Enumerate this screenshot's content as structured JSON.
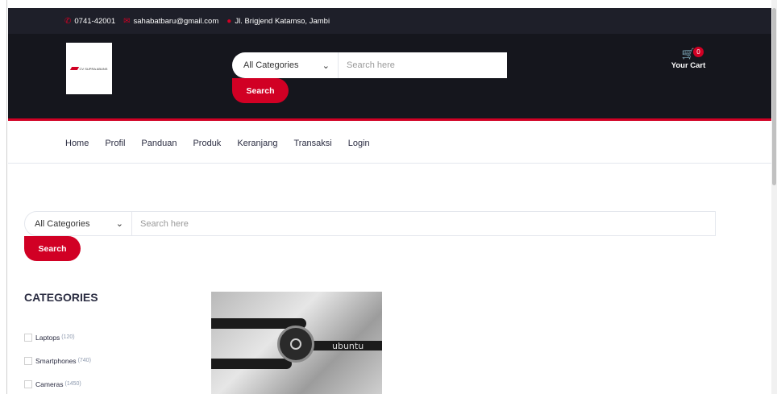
{
  "topbar": {
    "phone": "0741-42001",
    "email": "sahabatbaru@gmail.com",
    "address": "Jl. Brigjend Katamso, Jambi"
  },
  "header": {
    "logo_text": "CV SUPRA ABUNS",
    "search": {
      "category": "All Categories",
      "placeholder": "Search here",
      "button": "Search"
    },
    "cart": {
      "count": "0",
      "label": "Your Cart"
    }
  },
  "nav": {
    "items": [
      "Home",
      "Profil",
      "Panduan",
      "Produk",
      "Keranjang",
      "Transaksi",
      "Login"
    ]
  },
  "main_search": {
    "category": "All Categories",
    "placeholder": "Search here",
    "button": "Search"
  },
  "categories": {
    "title": "CATEGORIES",
    "items": [
      {
        "label": "Laptops",
        "count": "(120)"
      },
      {
        "label": "Smartphones",
        "count": "(740)"
      },
      {
        "label": "Cameras",
        "count": "(1450)"
      }
    ]
  },
  "product": {
    "image_text": "ubuntu"
  },
  "colors": {
    "accent": "#d10024",
    "header_bg": "#15161d",
    "topbar_bg": "#1e1f29"
  }
}
